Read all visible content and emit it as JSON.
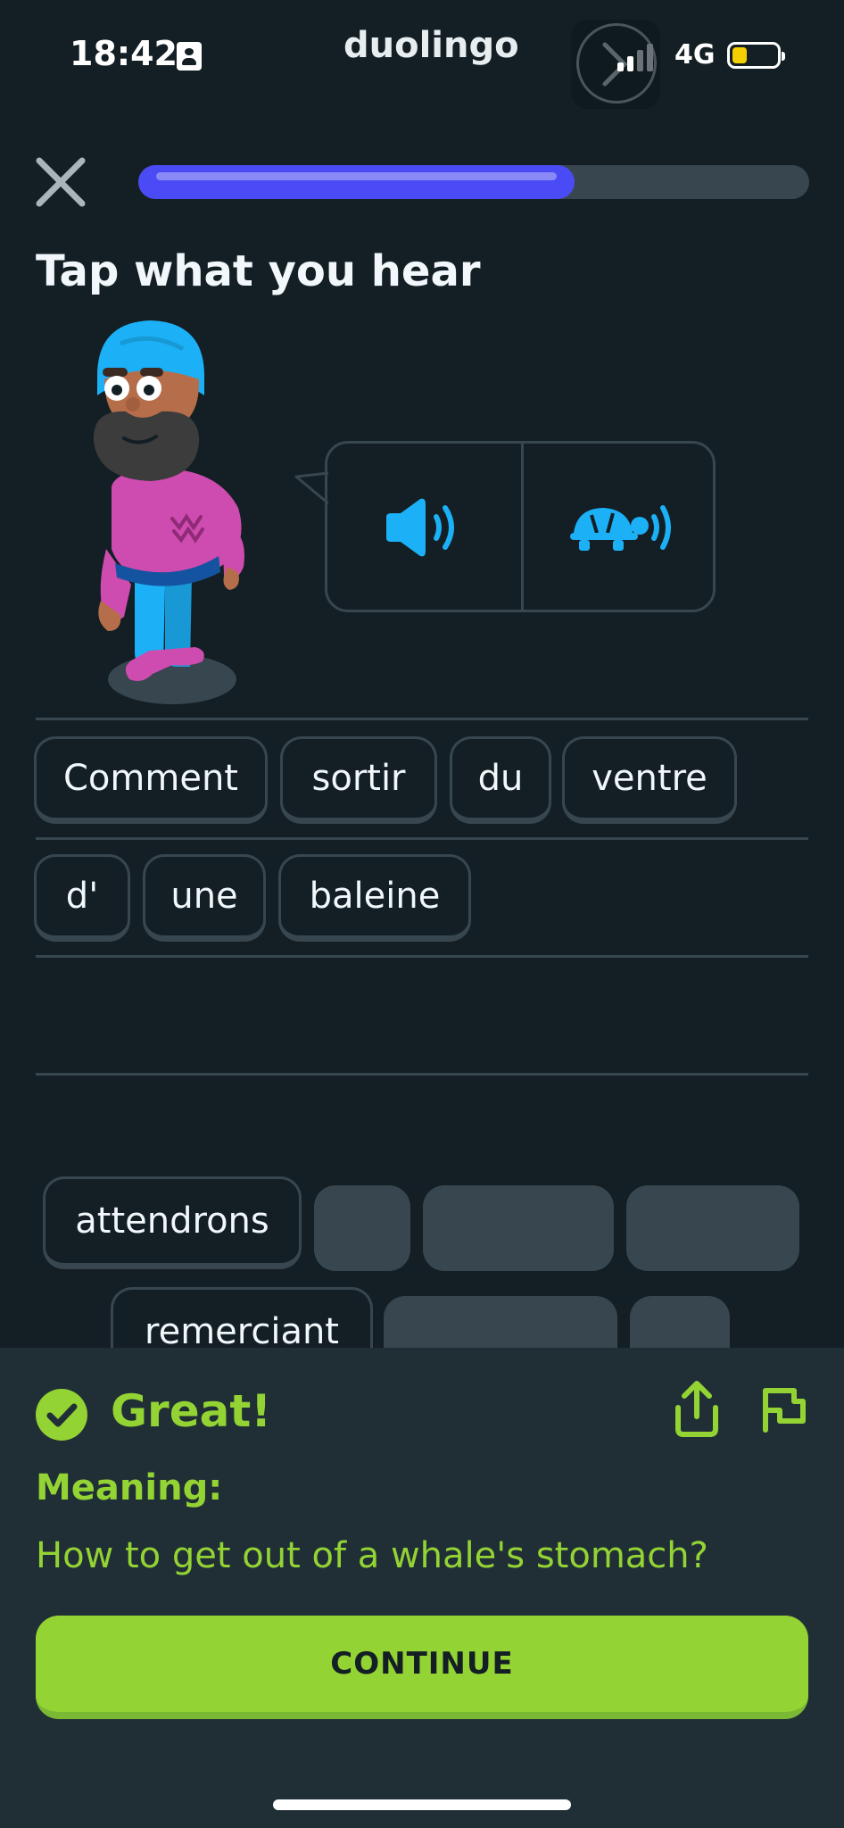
{
  "status_bar": {
    "time": "18:42",
    "app_name": "duolingo",
    "network": "4G",
    "battery_color": "#f5d000"
  },
  "progress": {
    "value": 0.65,
    "fill_color": "#4b4bf5"
  },
  "lesson": {
    "title": "Tap what you hear"
  },
  "icons": {
    "close": "close-icon",
    "speaker": "speaker-icon",
    "slow_speaker": "turtle-speaker-icon",
    "check": "check-circle-icon",
    "share": "share-icon",
    "flag": "flag-icon"
  },
  "answer": {
    "words": [
      "Comment",
      "sortir",
      "du",
      "ventre",
      "d'",
      "une",
      "baleine"
    ]
  },
  "word_bank": {
    "words": [
      "attendrons",
      "remerciant"
    ]
  },
  "feedback": {
    "status": "Great!",
    "meaning_label": "Meaning:",
    "meaning_text": "How to get out of a whale's stomach?",
    "continue_label": "CONTINUE",
    "accent_color": "#93d333"
  }
}
